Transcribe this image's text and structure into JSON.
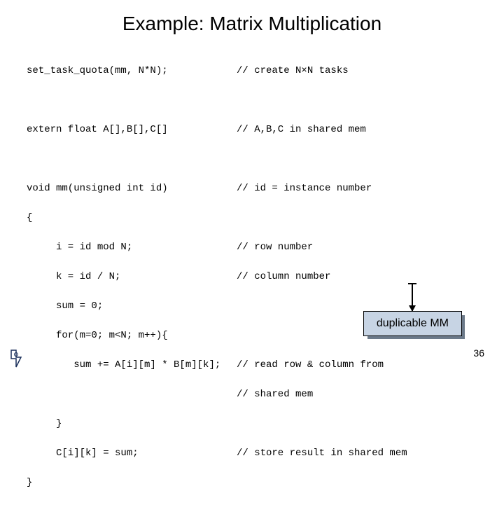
{
  "title": "Example: Matrix Multiplication",
  "code": {
    "l1_left": "set_task_quota(mm, N*N);",
    "l1_right": "// create N×N tasks",
    "l2_left": "extern float A[],B[],C[]",
    "l2_right": "// A,B,C in shared mem",
    "l3_left": "void mm(unsigned int id)",
    "l3_right": "// id = instance number",
    "l4_left": "{",
    "l5_left": "     i = id mod N;",
    "l5_right": "// row number",
    "l6_left": "     k = id / N;",
    "l6_right": "// column number",
    "l7_left": "     sum = 0;",
    "l8_left": "     for(m=0; m<N; m++){",
    "l9_left": "        sum += A[i][m] * B[m][k];",
    "l9_right": "// read row & column from",
    "l10_right": "// shared mem",
    "l11_left": "     }",
    "l12_left": "     C[i][k] = sum;",
    "l12_right": "// store result in shared mem",
    "l13_left": "}"
  },
  "annotation": "duplicable MM",
  "page_number": "36"
}
